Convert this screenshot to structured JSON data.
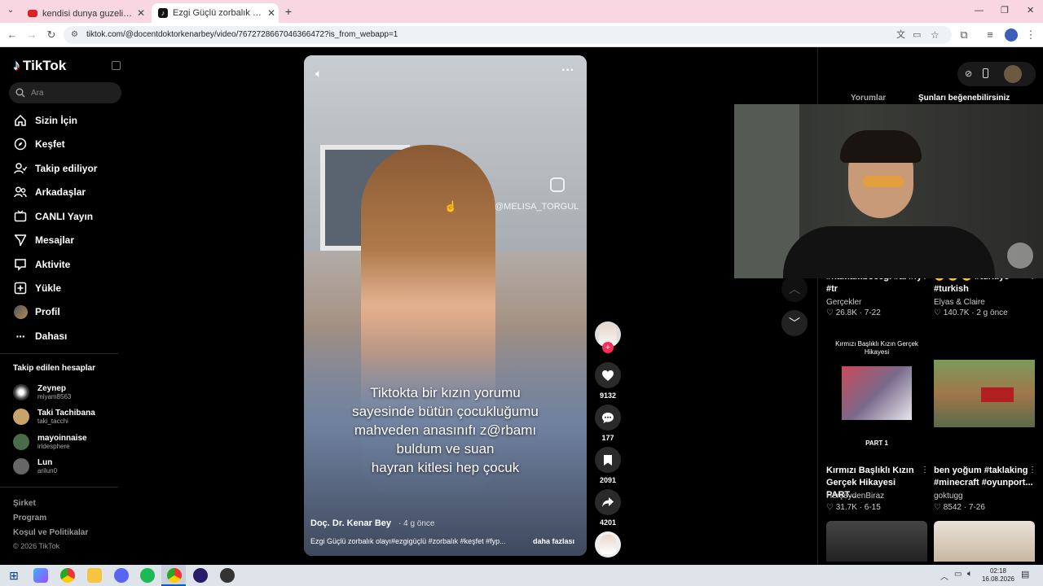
{
  "browser": {
    "tabs": [
      {
        "title": "kendisi dunya guzeli sanki 🕵️ ="
      },
      {
        "title": "Ezgi Güçlü zorbalık olayı nedir?"
      }
    ],
    "url": "tiktok.com/@docentdoktorkenarbey/video/7672728667046366472?is_from_webapp=1"
  },
  "sidebar": {
    "logo": "TikTok",
    "search_placeholder": "Ara",
    "nav": [
      {
        "label": "Sizin İçin",
        "icon": "home-icon"
      },
      {
        "label": "Keşfet",
        "icon": "compass-icon"
      },
      {
        "label": "Takip ediliyor",
        "icon": "following-icon"
      },
      {
        "label": "Arkadaşlar",
        "icon": "friends-icon"
      },
      {
        "label": "CANLI Yayın",
        "icon": "live-icon"
      },
      {
        "label": "Mesajlar",
        "icon": "messages-icon"
      },
      {
        "label": "Aktivite",
        "icon": "activity-icon"
      },
      {
        "label": "Yükle",
        "icon": "upload-icon"
      },
      {
        "label": "Profil",
        "icon": "profile-icon"
      },
      {
        "label": "Dahası",
        "icon": "more-icon"
      }
    ],
    "following_title": "Takip edilen hesaplar",
    "following": [
      {
        "name": "Zeynep",
        "handle": "miyam8563"
      },
      {
        "name": "Taki Tachibana",
        "handle": "taki_tacchi"
      },
      {
        "name": "mayoinnaise",
        "handle": "iridesphere"
      },
      {
        "name": "Lun",
        "handle": "arilun0"
      }
    ],
    "footer": [
      "Şirket",
      "Program",
      "Koşul ve Politikalar",
      "© 2026 TikTok"
    ]
  },
  "video": {
    "watermark": "@MELISA_TORGUL",
    "caption_lines": [
      "Tiktokta bir kızın yorumu",
      "sayesinde bütün çocukluğumu",
      "mahveden anasınıfı z@rbamı",
      "buldum ve suan",
      "hayran kitlesi hep çocuk"
    ],
    "author": "Doç. Dr. Kenar Bey",
    "time": "· 4 g önce",
    "description": "Ezgi Güçlü zorbalık olayı#ezgigüçlü #zorbalık #keşfet #fyp...",
    "more": "daha fazlası"
  },
  "actions": {
    "likes": "9132",
    "comments": "177",
    "saves": "2091",
    "shares": "4201"
  },
  "right_panel": {
    "tabs": [
      "Yorumlar",
      "Şunları beğenebilirsiniz"
    ],
    "cards": [
      {
        "title_l1": "#hamambocegi #ai #fy",
        "title_l2": "#tr",
        "author": "Gerçekler",
        "likes": "26.8K",
        "date": "7-22"
      },
      {
        "title_l1": "😊 😊 😊 #turkiye",
        "title_l2": "#turkish",
        "author": "Elyas & Claire",
        "likes": "140.7K",
        "date": "2 g önce"
      },
      {
        "thumb_text": "Kırmızı Başlıklı Kızın Gerçek Hikayesi",
        "thumb_sub": "PART 1",
        "title_l1": "Kırmızı Başlıklı Kızın",
        "title_l2": "Gerçek Hikayesi PART...",
        "author": "HerşeydenBiraz",
        "likes": "31.7K",
        "date": "6-15"
      },
      {
        "title_l1": "ben yoğum #taklaking",
        "title_l2": "#minecraft #oyunport...",
        "author": "goktugg",
        "likes": "8542",
        "date": "7-26"
      }
    ]
  },
  "taskbar": {
    "time": "02:18",
    "date": "16.08.2026"
  }
}
